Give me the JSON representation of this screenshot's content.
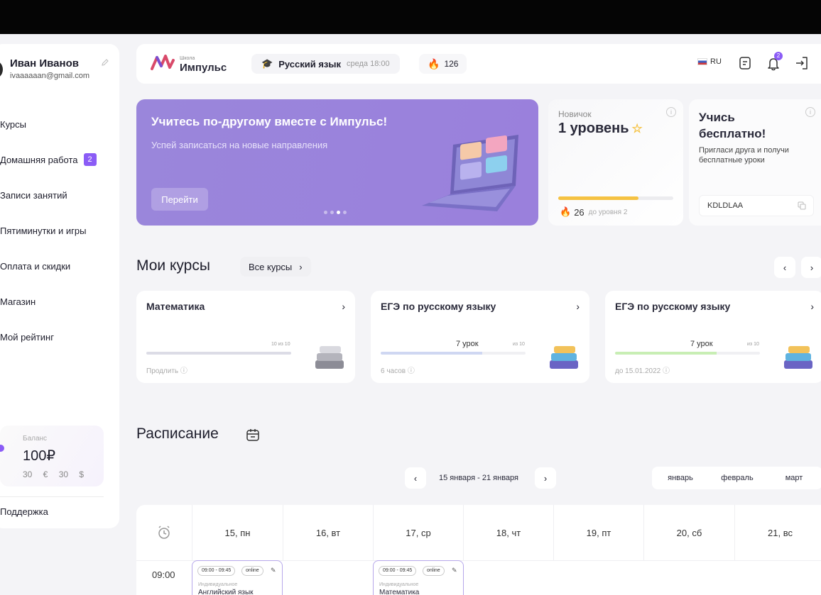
{
  "user": {
    "name": "Иван Иванов",
    "email": "ivaaaaaan@gmail.com"
  },
  "nav": [
    {
      "label": "Курсы"
    },
    {
      "label": "Домашняя работа",
      "badge": "2"
    },
    {
      "label": "Записи занятий"
    },
    {
      "label": "Пятиминутки и игры"
    },
    {
      "label": "Оплата и скидки"
    },
    {
      "label": "Магазин"
    },
    {
      "label": "Мой рейтинг"
    }
  ],
  "balance": {
    "label": "Баланс",
    "value": "100₽",
    "sub": "30 € 30 $"
  },
  "support": "Поддержка",
  "header": {
    "logo_small": "Школа",
    "logo_name": "Импульс",
    "subject": "Русский язык",
    "subject_time": "среда 18:00",
    "streak": "126",
    "lang": "RU",
    "notifications": "2"
  },
  "banner": {
    "title": "Учитесь по-другому вместе с Импульс!",
    "subtitle": "Успей записаться  на новые направления",
    "button": "Перейти"
  },
  "level": {
    "label": "Новичок",
    "value": "1 уровень",
    "points": "26",
    "to_next": "до уровня 2",
    "progress": 0.7
  },
  "invite": {
    "title": "Учись бесплатно!",
    "desc": "Пригласи друга и получи бесплатные уроки",
    "code": "KDLDLAA"
  },
  "courses": {
    "title": "Мои курсы",
    "all": "Все курсы",
    "items": [
      {
        "title": "Математика",
        "lesson": "",
        "count": "10 из 10",
        "foot": "Продлить",
        "progress": 1.0,
        "color": "#dcdce6"
      },
      {
        "title": "ЕГЭ по русскому языку",
        "lesson": "7 урок",
        "count": "из 10",
        "foot": "6 часов",
        "progress": 0.7,
        "color": "#cfd7f2"
      },
      {
        "title": "ЕГЭ по русскому языку",
        "lesson": "7 урок",
        "count": "из 10",
        "foot": "до 15.01.2022",
        "progress": 0.7,
        "color": "#c8eeb4"
      }
    ]
  },
  "schedule": {
    "title": "Расписание",
    "range": "15 января - 21 января",
    "months": [
      "январь",
      "февраль",
      "март"
    ],
    "days": [
      "15, пн",
      "16, вт",
      "17, ср",
      "18, чт",
      "19, пт",
      "20, сб",
      "21, вс"
    ],
    "time": "09:00",
    "lessons": [
      {
        "time": "09:00 - 09:45",
        "mode": "online",
        "kind": "Индивидуальное",
        "name": "Английский язык"
      },
      {
        "time": "09:00 - 09:45",
        "mode": "online",
        "kind": "Индивидуальное",
        "name": "Математика"
      }
    ]
  }
}
